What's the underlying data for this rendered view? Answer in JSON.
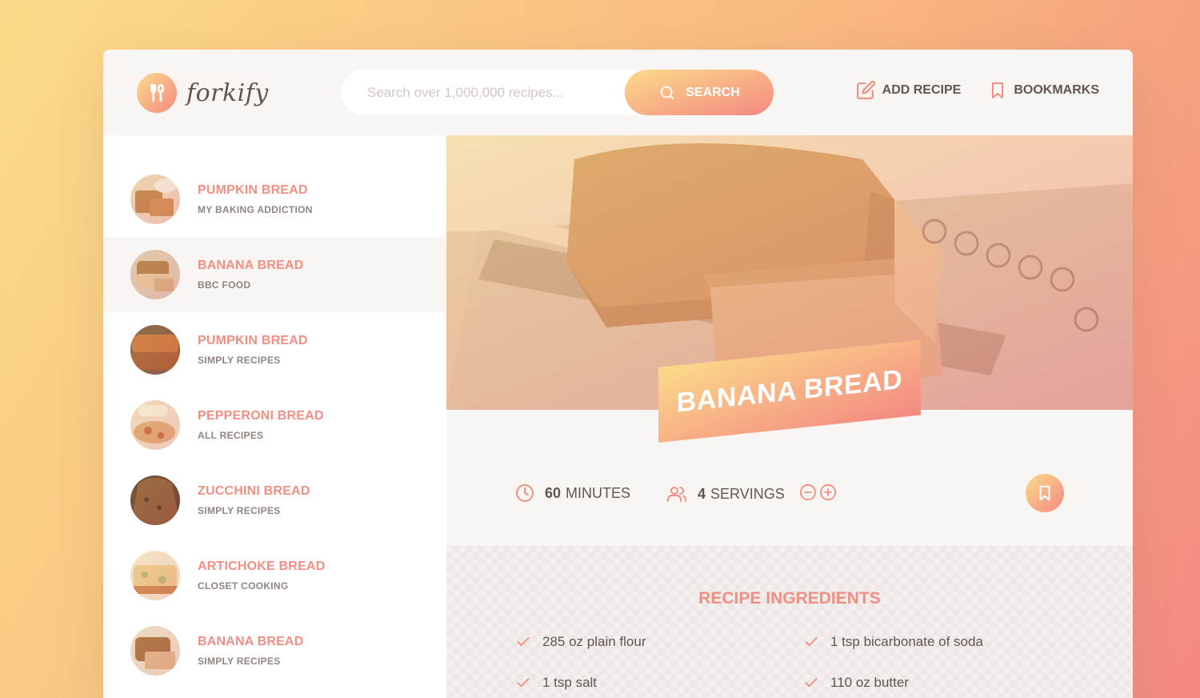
{
  "app": {
    "name": "forkify"
  },
  "search": {
    "placeholder": "Search over 1,000,000 recipes...",
    "button_label": "Search"
  },
  "nav": {
    "add_recipe": "Add recipe",
    "bookmarks": "Bookmarks"
  },
  "results": [
    {
      "title": "Pumpkin Bread",
      "publisher": "My Baking Addiction",
      "active": false
    },
    {
      "title": "Banana Bread",
      "publisher": "BBC Food",
      "active": true
    },
    {
      "title": "Pumpkin Bread",
      "publisher": "Simply Recipes",
      "active": false
    },
    {
      "title": "Pepperoni Bread",
      "publisher": "All Recipes",
      "active": false
    },
    {
      "title": "Zucchini Bread",
      "publisher": "Simply Recipes",
      "active": false
    },
    {
      "title": "Artichoke Bread",
      "publisher": "Closet Cooking",
      "active": false
    },
    {
      "title": "Banana Bread",
      "publisher": "Simply Recipes",
      "active": false
    }
  ],
  "recipe": {
    "title": "Banana Bread",
    "minutes": "60",
    "minutes_label": "minutes",
    "servings": "4",
    "servings_label": "servings",
    "ingredients_heading": "Recipe ingredients",
    "ingredients": [
      "285 oz plain flour",
      "1 tsp bicarbonate of soda",
      "1 tsp salt",
      "110 oz butter"
    ]
  },
  "icons": {
    "logo": "fork-spoon-icon",
    "search": "search-icon",
    "add": "edit-icon",
    "bookmark": "bookmark-icon",
    "clock": "clock-icon",
    "users": "users-icon",
    "minus": "minus-circle-icon",
    "plus": "plus-circle-icon",
    "check": "check-icon"
  },
  "colors": {
    "accent": "#f38e82",
    "gradient_start": "#fbdb89",
    "gradient_end": "#f48982",
    "text": "#615551"
  }
}
